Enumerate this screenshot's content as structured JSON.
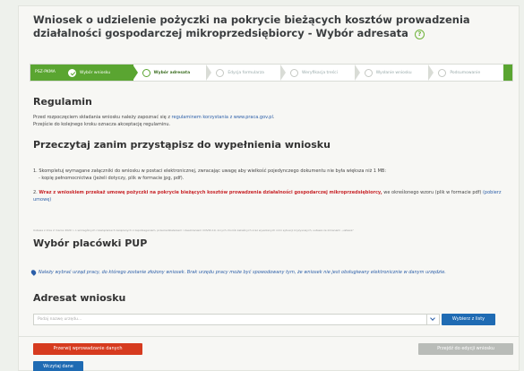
{
  "header": {
    "title": "Wniosek o udzielenie pożyczki na pokrycie bieżących kosztów prowadzenia działalności gospodarczej mikroprzedsiębiorcy - Wybór adresata"
  },
  "steps": {
    "start": "PSZ-PKMA",
    "items": [
      {
        "label": "Wybór wniosku",
        "state": "done"
      },
      {
        "label": "Wybór adresata",
        "state": "active"
      },
      {
        "label": "Edycja formularza",
        "state": "todo"
      },
      {
        "label": "Weryfikacja treści",
        "state": "todo"
      },
      {
        "label": "Wysłanie wniosku",
        "state": "todo"
      },
      {
        "label": "Podsumowanie",
        "state": "todo"
      }
    ]
  },
  "regulamin": {
    "heading": "Regulamin",
    "line1_pre": "Przed rozpoczęciem składania wniosku należy zapoznać się z",
    "line1_link": "regulaminem korzystania z www.praca.gov.pl",
    "line1_post": ".",
    "line2": "Przejście do kolejnego kroku oznacza akceptację regulaminu."
  },
  "przeczytaj": {
    "heading": "Przeczytaj zanim przystąpisz do wypełnienia wniosku",
    "item1": "1. Skompletuj wymagane załączniki do wniosku w postaci elektronicznej, zwracając uwagę aby wielkość pojedynczego dokumentu nie była większa niż 1 MB:",
    "item1b": "- kopię pełnomocnictwa (jeżeli dotyczy, plik w formacie jpg, pdf).",
    "item2_num": "2.",
    "item2_red": "Wraz z wnioskiem przekaż umowę pożyczki na pokrycie bieżących kosztów prowadzenia działalności gospodarczej mikroprzedsiębiorcy,",
    "item2_post": "we określonego wzoru (plik w formacie pdf)",
    "item2_link": "(pobierz umowę)",
    "footnote": "Ustawa z dnia 2 marca 2020 r. o szczególnych rozwiązaniach związanych z zapobieganiem, przeciwdziałaniem i zwalczaniem COVID-19, innych chorób zakaźnych oraz wywołanych nimi sytuacji kryzysowych, ustawa ze zmianami „ustawa”"
  },
  "placowka": {
    "heading": "Wybór placówki PUP",
    "info": "Należy wybrać urząd pracy, do którego zostanie złożony wniosek. Brak urzędu pracy może być spowodowany tym, że wniosek nie jest obsługiwany elektronicznie w danym urzędzie."
  },
  "adresat": {
    "heading": "Adresat wniosku",
    "placeholder": "Podaj nazwę urzędu...",
    "list_button": "Wybierz z listy"
  },
  "footer": {
    "cancel_button": "Przerwij wprowadzanie danych",
    "next_button": "Przejdź do edycji wniosku",
    "load_button": "Wczytaj dane"
  },
  "colors": {
    "accent_green": "#5aa531",
    "primary_blue": "#1f6bb3",
    "danger_red": "#d63b1f"
  }
}
